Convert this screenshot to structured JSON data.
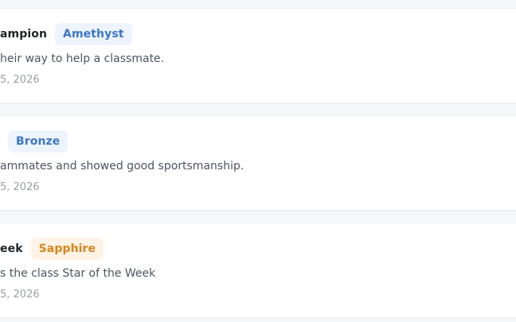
{
  "cards": [
    {
      "title": "ampion",
      "badge": "Amethyst",
      "description": "heir way to help a classmate.",
      "date": "5, 2026"
    },
    {
      "title": "",
      "badge": "Bronze",
      "description": "ammates and showed good sportsmanship.",
      "date": "5, 2026"
    },
    {
      "title": "eek",
      "badge": "Sapphire",
      "description": "s the class Star of the Week",
      "date": "5, 2026"
    }
  ],
  "colors": {
    "badge_blue_bg": "#eef4ff",
    "badge_blue_text": "#3b77c8",
    "badge_orange_bg": "#fff3e6",
    "badge_orange_text": "#d7861d"
  }
}
